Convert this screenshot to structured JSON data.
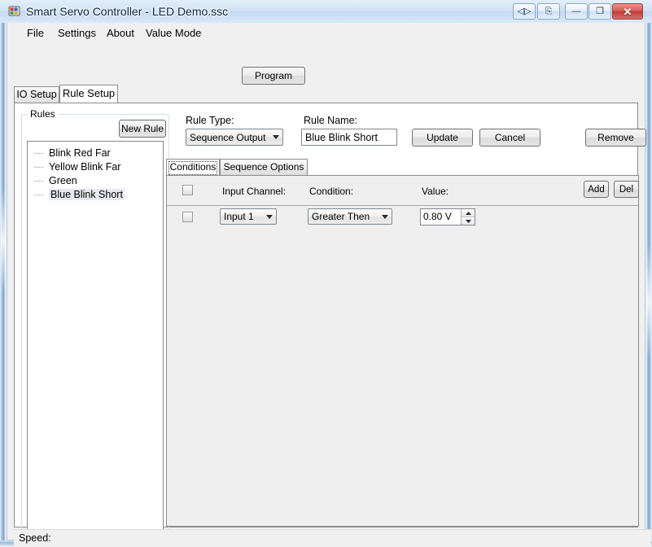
{
  "window": {
    "title": "Smart Servo Controller - LED Demo.ssc",
    "icon": "application-icon",
    "controls": {
      "extra1": "◁▷",
      "extra2": "⎘",
      "minimize": "—",
      "maximize": "❐",
      "close": "✕"
    }
  },
  "menu": {
    "items": [
      {
        "label": "File"
      },
      {
        "label": "Settings"
      },
      {
        "label": "About"
      },
      {
        "label": "Value Mode"
      }
    ]
  },
  "toolbar": {
    "program_label": "Program"
  },
  "tabs": {
    "items": [
      {
        "label": "IO Setup",
        "active": false
      },
      {
        "label": "Rule Setup",
        "active": true
      }
    ]
  },
  "rules_panel": {
    "legend": "Rules",
    "new_rule_label": "New Rule",
    "items": [
      {
        "label": "Blink Red Far",
        "selected": false
      },
      {
        "label": "Yellow Blink Far",
        "selected": false
      },
      {
        "label": "Green",
        "selected": false
      },
      {
        "label": "Blue Blink Short",
        "selected": true
      }
    ]
  },
  "rule_editor": {
    "rule_type_label": "Rule Type:",
    "rule_type_value": "Sequence Output",
    "rule_name_label": "Rule Name:",
    "rule_name_value": "Blue Blink Short",
    "rule_name_placeholder": "",
    "update_label": "Update",
    "cancel_label": "Cancel",
    "remove_label": "Remove"
  },
  "inner_tabs": {
    "items": [
      {
        "label": "Conditions",
        "active": true
      },
      {
        "label": "Sequence Options",
        "active": false
      }
    ]
  },
  "conditions_grid": {
    "headers": {
      "input_channel": "Input Channel:",
      "condition": "Condition:",
      "value": "Value:"
    },
    "add_label": "Add",
    "del_label": "Del",
    "rows": [
      {
        "checked": false,
        "input_channel": "Input 1",
        "condition": "Greater Then",
        "value": "0.80 V"
      }
    ]
  },
  "statusbar": {
    "speed_label": "Speed:"
  },
  "colors": {
    "titlebar": "#cfe0f3",
    "close_button": "#bf3c36",
    "client_background": "#f0f0f0",
    "panel_background": "#efefef",
    "selection": "#e8e8f0"
  }
}
